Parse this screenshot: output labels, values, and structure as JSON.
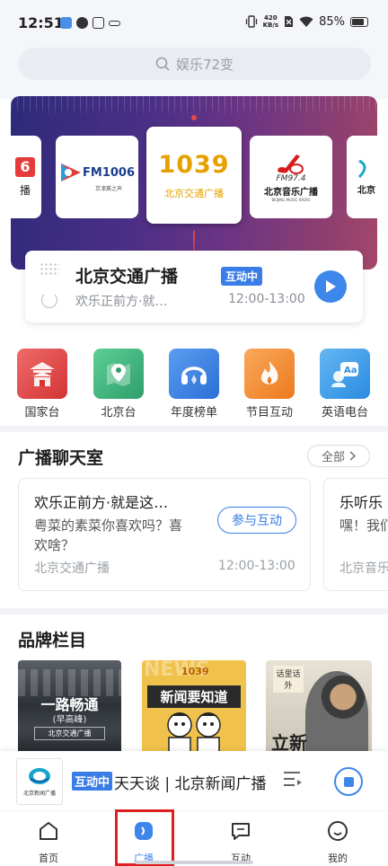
{
  "status_bar": {
    "time": "12:51",
    "net_speed_value": "420",
    "net_speed_unit": "KB/s",
    "battery": "85%"
  },
  "search": {
    "placeholder": "娱乐72变"
  },
  "banner": {
    "stations": [
      {
        "name": "left-partial-station",
        "label": "6"
      },
      {
        "name": "fm1006",
        "label": "FM1006",
        "sub": "京津冀之声"
      },
      {
        "name": "fm1039",
        "label": "1039",
        "sub": "北京交通广播"
      },
      {
        "name": "fm974",
        "label": "FM97.4",
        "sub": "北京音乐广播",
        "sub2": "BEIJING MUSIC RADIO"
      },
      {
        "name": "right-partial-station",
        "label": "北京"
      }
    ]
  },
  "now_playing": {
    "title": "北京交通广播",
    "badge": "互动中",
    "program": "欢乐正前方·就…",
    "time": "12:00-13:00"
  },
  "categories": [
    {
      "label": "国家台",
      "icon": "temple-icon",
      "color": "#e24a4a"
    },
    {
      "label": "北京台",
      "icon": "map-pin-icon",
      "color": "#3bb07a"
    },
    {
      "label": "年度榜单",
      "icon": "headphones-icon",
      "color": "#3d82e8"
    },
    {
      "label": "节目互动",
      "icon": "flame-icon",
      "color": "#f08a2c"
    },
    {
      "label": "英语电台",
      "icon": "chat-aa-icon",
      "color": "#3a9eea"
    }
  ],
  "chat_room": {
    "title": "广播聊天室",
    "more_label": "全部",
    "cards": [
      {
        "title": "欢乐正前方·就是这…",
        "message_line1": "粤菜的素菜你喜欢吗？喜",
        "message_line2": "欢啥？",
        "station": "北京交通广播",
        "time": "12:00-13:00",
        "join_label": "参与互动"
      },
      {
        "title": "乐听乐",
        "message_line1": "嘿！我们",
        "message_line2": "",
        "station": "北京音乐",
        "time": "",
        "join_label": ""
      }
    ]
  },
  "brand": {
    "title": "品牌栏目",
    "items": [
      {
        "title": "一路畅通",
        "sub": "(早高峰)",
        "station": "北京交通广播"
      },
      {
        "title": "新闻要知道",
        "brand": "1039",
        "station": "北京交通广播",
        "overlay": "NEWS"
      },
      {
        "title": "立新",
        "tag": "话里话外"
      }
    ]
  },
  "mini_player": {
    "badge": "互动中",
    "title": "天天谈 | 北京新闻广播",
    "logo_text": "北京新闻广播"
  },
  "tabbar": {
    "tabs": [
      {
        "label": "首页",
        "icon": "home-icon"
      },
      {
        "label": "广播",
        "icon": "radio-icon"
      },
      {
        "label": "互动",
        "icon": "chat-bubble-icon"
      },
      {
        "label": "我的",
        "icon": "profile-icon"
      }
    ]
  },
  "colors": {
    "accent": "#3d86ea",
    "highlight": "#e02020"
  }
}
